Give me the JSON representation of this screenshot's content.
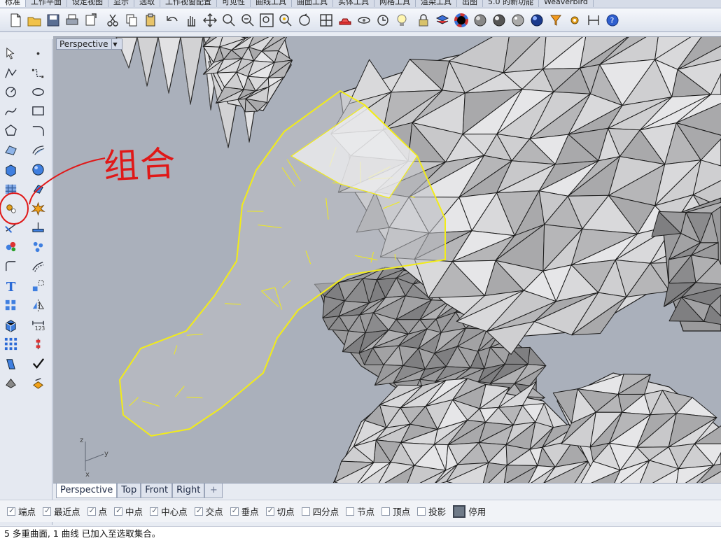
{
  "menu_tabs": [
    "标准",
    "工作平面",
    "设定视图",
    "显示",
    "选取",
    "工作视窗配置",
    "可见性",
    "曲线工具",
    "曲面工具",
    "实体工具",
    "网格工具",
    "渲染工具",
    "出图",
    "5.0 的新功能",
    "Weaverbird"
  ],
  "active_menu_tab": 0,
  "toolbar_icons": [
    "new-file-icon",
    "open-file-icon",
    "save-icon",
    "print-icon",
    "export-icon",
    "cut-icon",
    "copy-icon",
    "paste-icon",
    "undo-icon",
    "pan-hand-icon",
    "move-view-icon",
    "zoom-icon",
    "zoom-window-icon",
    "zoom-extents-icon",
    "zoom-selected-icon",
    "rotate-view-icon",
    "four-views-icon",
    "car-icon",
    "hide-icon",
    "lock-icon",
    "light-icon",
    "lock-padlock-icon",
    "layer-icon",
    "color-wheel-icon",
    "shaded-sphere-icon",
    "rendered-sphere-icon",
    "ghosted-sphere-icon",
    "render-sphere-icon",
    "filter-icon",
    "gear-options-icon",
    "dimension-icon",
    "help-icon"
  ],
  "left_tools": [
    "select-arrow-icon",
    "point-icon",
    "polyline-icon",
    "control-points-icon",
    "circle-icon",
    "ellipse-icon",
    "curve-icon",
    "rectangle-icon",
    "polygon-icon",
    "fillet-curve-icon",
    "surface-icon",
    "sweep-icon",
    "box-solid-icon",
    "sphere-solid-icon",
    "mesh-icon",
    "extrude-icon",
    "join-icon",
    "explode-icon",
    "trim-icon",
    "split-icon",
    "group-icon",
    "ungroup-icon",
    "fillet-icon",
    "offset-icon",
    "text-icon",
    "transform-icon",
    "array-icon",
    "mirror-icon",
    "block-icon",
    "dimension-icon",
    "grid-icon",
    "history-icon",
    "cage-icon",
    "check-icon",
    "analyze-icon",
    "render-icon"
  ],
  "viewport": {
    "title": "Perspective",
    "axis_labels": {
      "z": "z",
      "y": "y",
      "x": "x"
    }
  },
  "annotation": {
    "text": "组合",
    "color": "#e01818"
  },
  "view_tabs": [
    "Perspective",
    "Top",
    "Front",
    "Right"
  ],
  "active_view_tab": 0,
  "add_view_tab": "+",
  "osnap": [
    {
      "label": "端点",
      "checked": true
    },
    {
      "label": "最近点",
      "checked": true
    },
    {
      "label": "点",
      "checked": true
    },
    {
      "label": "中点",
      "checked": true
    },
    {
      "label": "中心点",
      "checked": true
    },
    {
      "label": "交点",
      "checked": true
    },
    {
      "label": "垂点",
      "checked": true
    },
    {
      "label": "切点",
      "checked": true
    },
    {
      "label": "四分点",
      "checked": false
    },
    {
      "label": "节点",
      "checked": false
    },
    {
      "label": "顶点",
      "checked": false
    },
    {
      "label": "投影",
      "checked": false
    }
  ],
  "osnap_disable_label": "停用",
  "command_line": "5 多重曲面, 1 曲线 已加入至选取集合。",
  "colors": {
    "selection": "#f2ec18",
    "viewport_bg": "#aab0bb",
    "mesh_fill": "#c9c9cb",
    "mesh_edge": "#222222"
  }
}
